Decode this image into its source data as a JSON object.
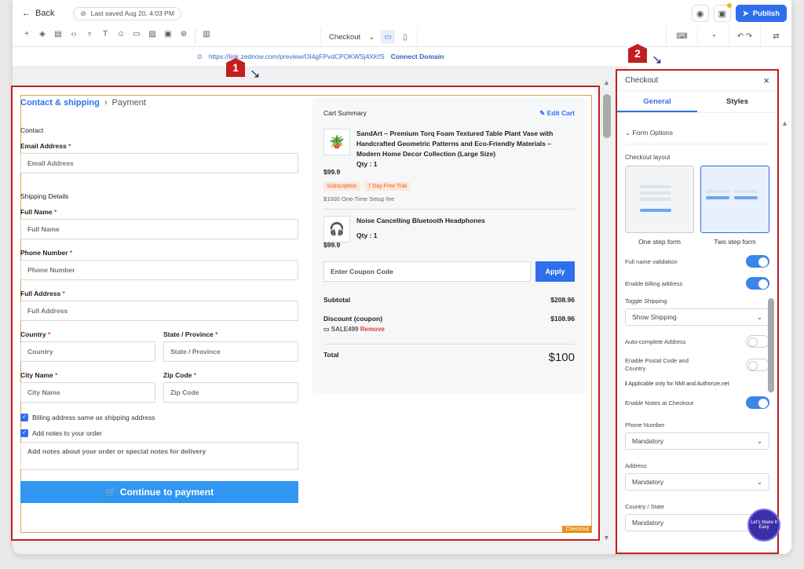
{
  "header": {
    "back_label": "Back",
    "saved_label": "Last saved Aug 20, 4:03 PM",
    "publish_label": "Publish"
  },
  "toolbar": {
    "page_select": "Checkout"
  },
  "url_bar": {
    "url": "https://link.zednow.com/preview/OI4gFPvdCPOKWSj4XKfS",
    "connect_label": "Connect Domain"
  },
  "annotations": {
    "one": "1",
    "two": "2"
  },
  "checkout": {
    "tag": "Checkout",
    "breadcrumb": {
      "active": "Contact & shipping",
      "sep": "›",
      "next": "Payment"
    },
    "contact_heading": "Contact",
    "email_label": "Email Address",
    "email_placeholder": "Email Address",
    "shipping_heading": "Shipping Details",
    "fullname_label": "Full Name",
    "fullname_placeholder": "Full Name",
    "phone_label": "Phone Number",
    "phone_placeholder": "Phone Number",
    "address_label": "Full Address",
    "address_placeholder": "Full Address",
    "country_label": "Country",
    "country_placeholder": "Country",
    "state_label": "State / Province",
    "state_placeholder": "State / Province",
    "city_label": "City Name",
    "city_placeholder": "City Name",
    "zip_label": "Zip Code",
    "zip_placeholder": "Zip Code",
    "billing_same": "Billing address same as shipping address",
    "add_notes": "Add notes to your order",
    "notes_placeholder": "Add notes about your order or special notes for delivery",
    "continue_label": "Continue to payment",
    "required_mark": "*"
  },
  "cart": {
    "title": "Cart Summary",
    "edit_label": "Edit Cart",
    "items": [
      {
        "name": "SandArt – Premium Torq Foam Textured Table Plant Vase with Handcrafted Geometric Patterns and Eco-Friendly Materials – Modern Home Decor Collection (Large Size)",
        "qty": "Qty : 1",
        "price": "$99.9"
      },
      {
        "name": "Noise Cancelling Bluetooth Headphones",
        "qty": "Qty : 1",
        "price": "$99.9"
      }
    ],
    "badges": [
      "Subscription",
      "7 Day Free Trial"
    ],
    "setup_fee": "$1000 One-Time Setup fee",
    "coupon_placeholder": "Enter Coupon Code",
    "apply_label": "Apply",
    "subtotal_label": "Subtotal",
    "subtotal_value": "$208.96",
    "discount_label": "Discount (coupon)",
    "discount_value": "$108.96",
    "coupon_code": "SALE499",
    "remove_label": "Remove",
    "total_label": "Total",
    "total_value": "$100"
  },
  "panel": {
    "title": "Checkout",
    "tabs": [
      "General",
      "Styles"
    ],
    "form_options": "Form Options",
    "layout_label": "Checkout layout",
    "layouts": [
      "One step form",
      "Two step form"
    ],
    "toggles": [
      {
        "label": "Full name validation",
        "on": true
      },
      {
        "label": "Enable billing address",
        "on": true
      }
    ],
    "toggle_shipping_label": "Toggle Shipping",
    "toggle_shipping_value": "Show Shipping",
    "autocomplete_label": "Auto-complete Address",
    "postal_label": "Enable Postal Code and Country",
    "note": "Applicable only for NMI and Authorize.net",
    "notes_label": "Enable Notes at Checkout",
    "phone_label": "Phone Number",
    "phone_value": "Mandatory",
    "address_label": "Address",
    "address_value": "Mandatory",
    "country_label": "Country / State",
    "country_value": "Mandatory"
  },
  "watermark": "Let's Make It Easy",
  "colors": {
    "accent": "#2f6fed",
    "annotation": "#c21f1f",
    "cta": "#3096f2"
  }
}
